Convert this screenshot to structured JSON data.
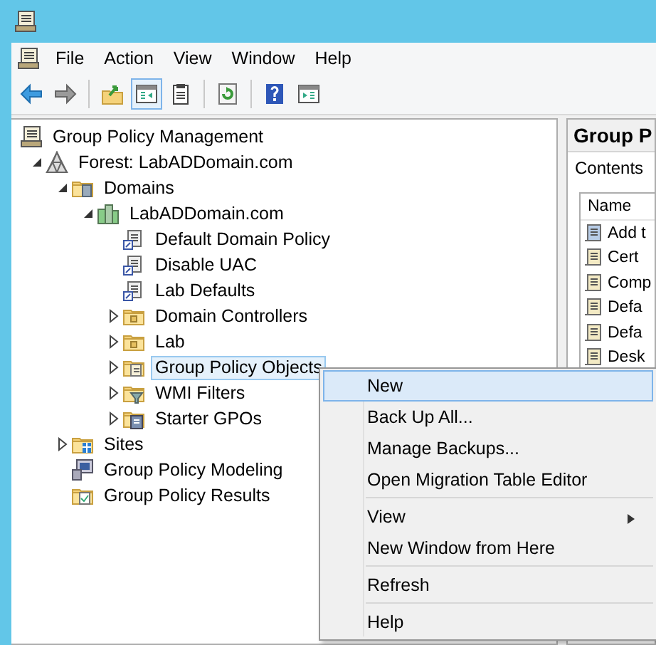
{
  "menu_bar": [
    "File",
    "Action",
    "View",
    "Window",
    "Help"
  ],
  "toolbar": [
    {
      "kind": "back",
      "pressed": false
    },
    {
      "kind": "forward",
      "pressed": false
    },
    {
      "kind": "separator"
    },
    {
      "kind": "up",
      "pressed": false
    },
    {
      "kind": "tree",
      "pressed": true
    },
    {
      "kind": "clipboard",
      "pressed": false
    },
    {
      "kind": "separator"
    },
    {
      "kind": "refresh",
      "pressed": false
    },
    {
      "kind": "separator"
    },
    {
      "kind": "help",
      "pressed": false
    },
    {
      "kind": "pane",
      "pressed": false
    }
  ],
  "tree": [
    {
      "label": "Group Policy Management",
      "kind": "console",
      "selected": false,
      "children": [
        {
          "label": "Forest: LabADDomain.com",
          "kind": "forest",
          "selected": false,
          "expanded": true,
          "children": [
            {
              "label": "Domains",
              "kind": "domains",
              "selected": false,
              "expanded": true,
              "children": [
                {
                  "label": "LabADDomain.com",
                  "kind": "domain",
                  "selected": false,
                  "expanded": true,
                  "children": [
                    {
                      "label": "Default Domain Policy",
                      "kind": "gpo-link",
                      "selected": false
                    },
                    {
                      "label": "Disable UAC",
                      "kind": "gpo-link",
                      "selected": false
                    },
                    {
                      "label": "Lab Defaults",
                      "kind": "gpo-link",
                      "selected": false
                    },
                    {
                      "label": "Domain Controllers",
                      "kind": "ou",
                      "selected": false,
                      "expanded": false
                    },
                    {
                      "label": "Lab",
                      "kind": "ou",
                      "selected": false,
                      "expanded": false
                    },
                    {
                      "label": "Group Policy Objects",
                      "kind": "gpo-folder",
                      "selected": true,
                      "expanded": false
                    },
                    {
                      "label": "WMI Filters",
                      "kind": "wmi-folder",
                      "selected": false,
                      "expanded": false
                    },
                    {
                      "label": "Starter GPOs",
                      "kind": "starter-folder",
                      "selected": false,
                      "expanded": false
                    }
                  ]
                }
              ]
            },
            {
              "label": "Sites",
              "kind": "sites",
              "selected": false,
              "expanded": false
            },
            {
              "label": "Group Policy Modeling",
              "kind": "modeling",
              "selected": false
            },
            {
              "label": "Group Policy Results",
              "kind": "results",
              "selected": false
            }
          ]
        }
      ]
    }
  ],
  "right_pane": {
    "title": "Group P",
    "tab": "Contents",
    "column": "Name",
    "rows": [
      {
        "label": "Add t",
        "kind": "blue"
      },
      {
        "label": "Cert",
        "kind": "plain"
      },
      {
        "label": "Comp",
        "kind": "plain"
      },
      {
        "label": "Defa",
        "kind": "plain"
      },
      {
        "label": "Defa",
        "kind": "plain"
      },
      {
        "label": "Desk",
        "kind": "plain"
      }
    ]
  },
  "context_menu": {
    "groups": [
      [
        {
          "label": "New",
          "selected": true,
          "submenu": false
        },
        {
          "label": "Back Up All...",
          "selected": false,
          "submenu": false
        },
        {
          "label": "Manage Backups...",
          "selected": false,
          "submenu": false
        },
        {
          "label": "Open Migration Table Editor",
          "selected": false,
          "submenu": false
        }
      ],
      [
        {
          "label": "View",
          "selected": false,
          "submenu": true
        },
        {
          "label": "New Window from Here",
          "selected": false,
          "submenu": false
        }
      ],
      [
        {
          "label": "Refresh",
          "selected": false,
          "submenu": false
        }
      ],
      [
        {
          "label": "Help",
          "selected": false,
          "submenu": false
        }
      ]
    ]
  }
}
